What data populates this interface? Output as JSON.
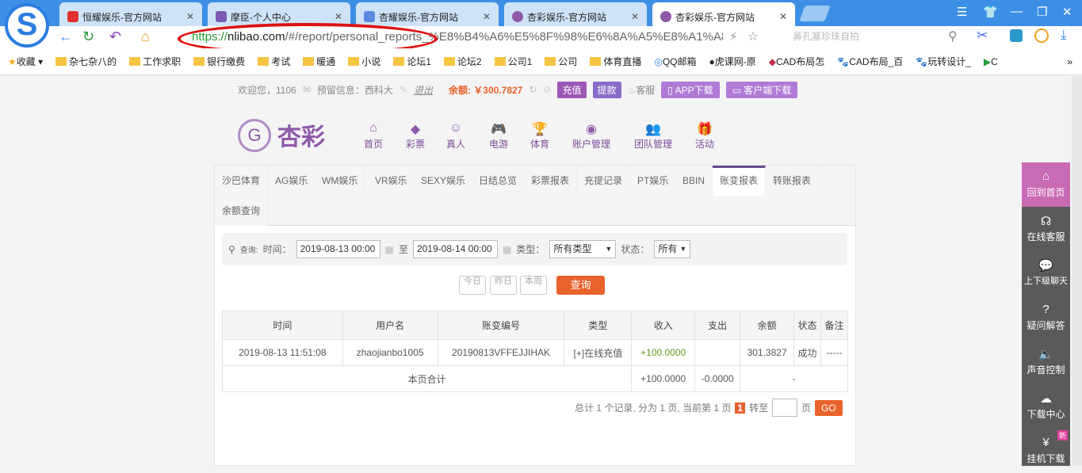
{
  "browser": {
    "tabs": [
      {
        "title": "恒耀娱乐-官方网站",
        "color": "#e03030"
      },
      {
        "title": "摩臣-个人中心",
        "color": "#7a5ab0"
      },
      {
        "title": "杏耀娱乐-官方网站",
        "color": "#5a8ae0"
      },
      {
        "title": "杏彩娱乐-官方网站",
        "color": "#8e5aa8"
      },
      {
        "title": "杏彩娱乐-官方网站",
        "color": "#8e5aa8"
      }
    ],
    "url_scheme": "https://",
    "url_host": "nlibao.com",
    "url_path": "/#/report/personal_reports_%E8%B4%A6%E5%8F%98%E6%8A%A5%E8%A1%A8",
    "search_placeholder": "鼻孔塞珍珠自拍",
    "bookmarks": [
      "收藏",
      "杂七杂八的",
      "工作求职",
      "银行缴费",
      "考试",
      "暖通",
      "小说",
      "论坛1",
      "论坛2",
      "公司1",
      "公司",
      "体育直播",
      "QQ邮箱",
      "虎课网-原",
      "CAD布局怎",
      "CAD布局_百",
      "玩转设计_",
      "C"
    ]
  },
  "top": {
    "welcome": "欢迎您，1106",
    "reserved": "预留信息：西科大",
    "logout": "退出",
    "balance": "余额: ￥300.7827",
    "recharge": "充值",
    "withdraw": "提款",
    "service": "客服",
    "app": "APP下载",
    "client": "客户端下载"
  },
  "brand": "杏彩",
  "nav": [
    {
      "label": "首页",
      "icon": "⌂"
    },
    {
      "label": "彩票",
      "icon": "◆"
    },
    {
      "label": "真人",
      "icon": "☺"
    },
    {
      "label": "电游",
      "icon": "🎮"
    },
    {
      "label": "体育",
      "icon": "🏆"
    },
    {
      "label": "账户管理",
      "icon": "◉"
    },
    {
      "label": "团队管理",
      "icon": "👥"
    },
    {
      "label": "活动",
      "icon": "🎁"
    }
  ],
  "report_tabs": [
    "沙巴体育",
    "AG娱乐",
    "WM娱乐",
    "VR娱乐",
    "SEXY娱乐",
    "日结总览",
    "彩票报表",
    "充提记录",
    "PT娱乐",
    "BBIN",
    "账变报表",
    "转账报表",
    "余额查询"
  ],
  "filter": {
    "query": "查询:",
    "time": "时间：",
    "start": "2019-08-13 00:00",
    "to": "至",
    "end": "2019-08-14 00:00",
    "type_label": "类型：",
    "type_value": "所有类型",
    "status_label": "状态：",
    "status_value": "所有"
  },
  "quick": [
    "今日",
    "昨日",
    "本周"
  ],
  "search_btn": "查询",
  "table": {
    "headers": [
      "时间",
      "用户名",
      "账变编号",
      "类型",
      "收入",
      "支出",
      "余额",
      "状态",
      "备注"
    ],
    "rows": [
      [
        "2019-08-13 11:51:08",
        "zhaojianbo1005",
        "20190813VFFEJJIHAK",
        "[+]在线充值",
        "+100.0000",
        "",
        "301.3827",
        "成功",
        "-----"
      ]
    ],
    "total": {
      "label": "本页合计",
      "income": "+100.0000",
      "expense": "-0.0000",
      "rest": "-"
    }
  },
  "pager": {
    "text": "总计 1 个记录, 分为 1 页, 当前第 1 页",
    "page": "1",
    "goto": "转至",
    "unit": "页",
    "go": "GO"
  },
  "side": [
    "回到首页",
    "在线客服",
    "上下级聊天",
    "疑问解答",
    "声音控制",
    "下载中心",
    "挂机下载"
  ],
  "side_badge": "新"
}
